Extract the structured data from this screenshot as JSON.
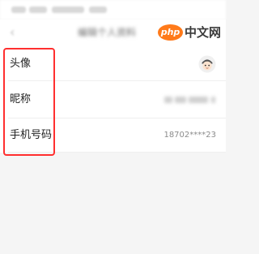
{
  "header": {
    "title": "编辑个人资料",
    "back_icon": "chevron-left-icon"
  },
  "brand": {
    "logo_text": "php",
    "site_text": "中文网",
    "color": "#ff7a1a"
  },
  "profile": {
    "rows": [
      {
        "label": "头像",
        "icon": "avatar-icon"
      },
      {
        "label": "昵称"
      },
      {
        "label": "手机号码",
        "value": "18702****23"
      }
    ]
  },
  "highlight": {
    "color": "#ff2f2f"
  }
}
